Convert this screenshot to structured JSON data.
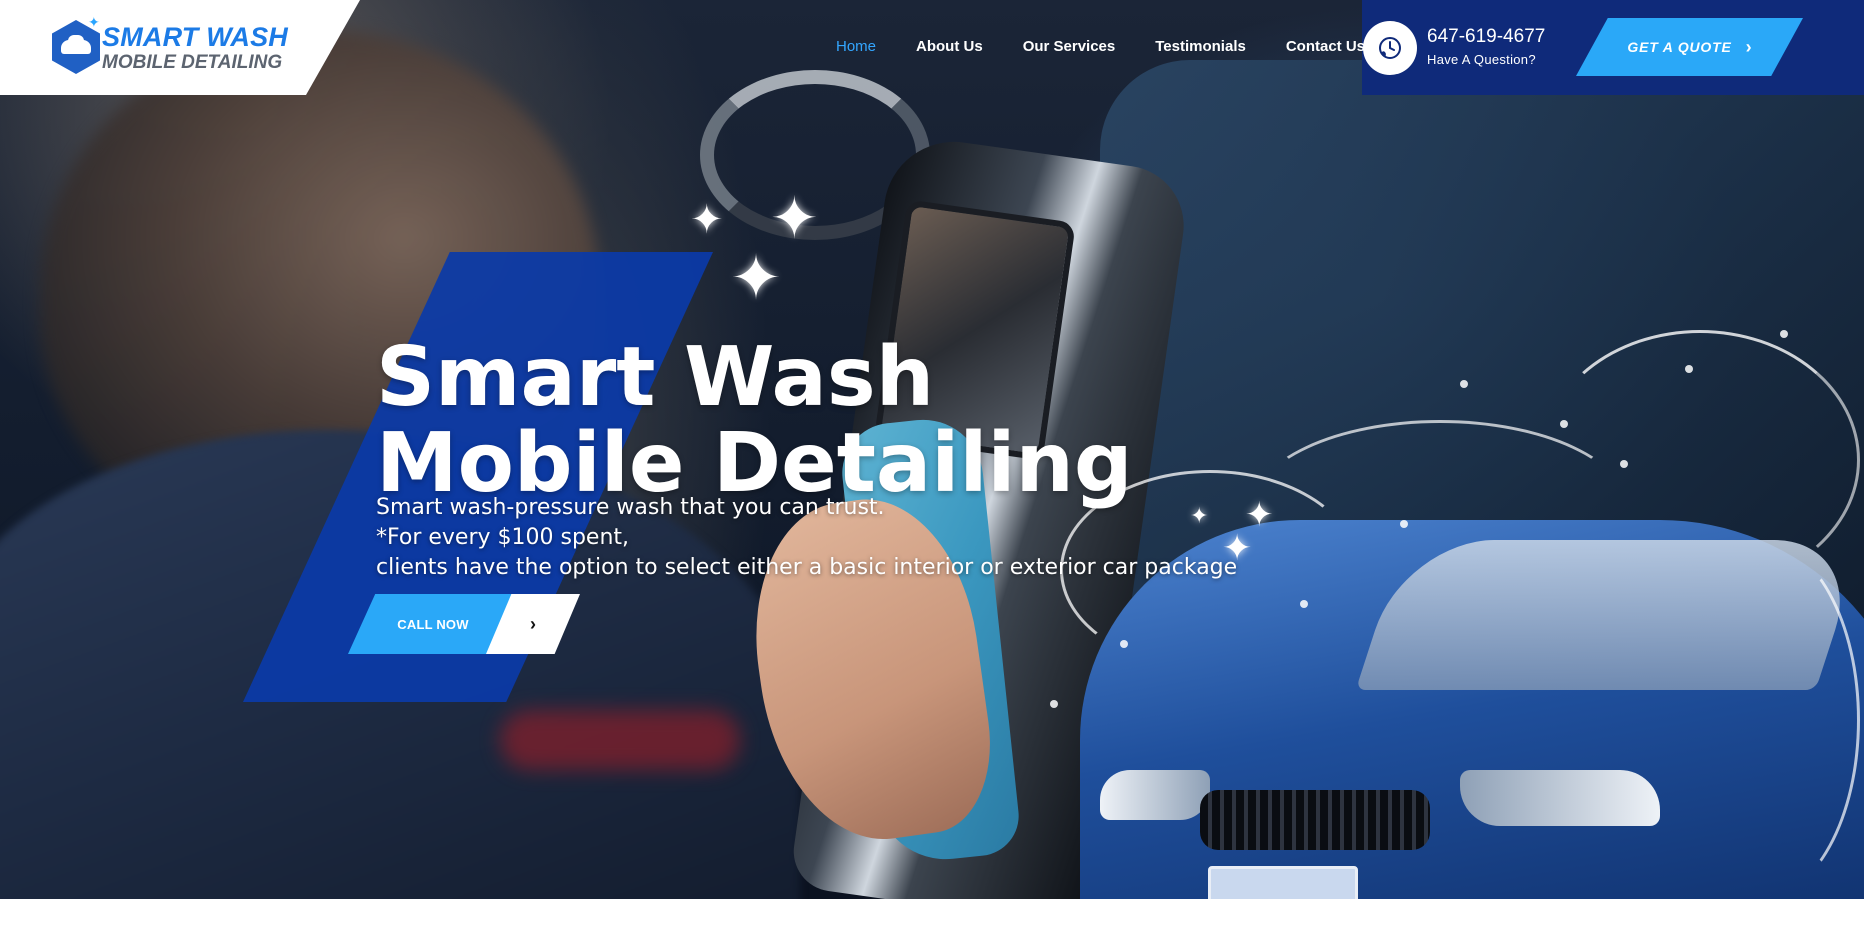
{
  "brand": {
    "title": "SMART WASH",
    "subtitle": "MOBILE DETAILING"
  },
  "nav": {
    "items": [
      {
        "label": "Home",
        "active": true
      },
      {
        "label": "About Us",
        "active": false
      },
      {
        "label": "Our Services",
        "active": false
      },
      {
        "label": "Testimonials",
        "active": false
      },
      {
        "label": "Contact Us",
        "active": false
      }
    ]
  },
  "contact": {
    "phone": "647-619-4677",
    "question": "Have A Question?",
    "icon": "phone-clock-icon"
  },
  "quote_button": {
    "label": "GET A QUOTE",
    "icon": "chevron-right-icon"
  },
  "hero": {
    "title_line1": "Smart Wash",
    "title_line2": "Mobile Detailing",
    "sub_line1": "Smart wash-pressure wash that you can trust.",
    "sub_line2": "*For every $100 spent,",
    "sub_line3": "clients have the option to select either a basic interior or exterior car package",
    "cta_label": "CALL NOW",
    "cta_icon": "chevron-right-icon"
  },
  "colors": {
    "accent": "#2aa8f8",
    "nav_active": "#33a6ff",
    "header_dark": "#0f2a7a",
    "hero_panel": "#0b3aa8",
    "brand_blue": "#1c7be6",
    "brand_gray": "#5c6470"
  }
}
